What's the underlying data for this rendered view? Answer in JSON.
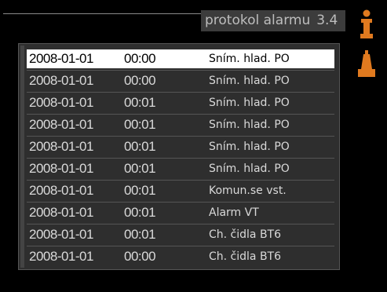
{
  "header": {
    "title": "protokol alarmu",
    "menu_number": "3.4"
  },
  "icons": {
    "info": "info-icon",
    "alarm": "alarm-lamp-icon",
    "accent_color": "#e07a1f"
  },
  "alarm_log": {
    "rows": [
      {
        "date": "2008-01-01",
        "time": "00:00",
        "alarm": "Sním. hlad. PO",
        "selected": true
      },
      {
        "date": "2008-01-01",
        "time": "00:00",
        "alarm": "Sním. hlad. PO",
        "selected": false
      },
      {
        "date": "2008-01-01",
        "time": "00:01",
        "alarm": "Sním. hlad. PO",
        "selected": false
      },
      {
        "date": "2008-01-01",
        "time": "00:01",
        "alarm": "Sním. hlad. PO",
        "selected": false
      },
      {
        "date": "2008-01-01",
        "time": "00:01",
        "alarm": "Sním. hlad. PO",
        "selected": false
      },
      {
        "date": "2008-01-01",
        "time": "00:01",
        "alarm": "Sním. hlad. PO",
        "selected": false
      },
      {
        "date": "2008-01-01",
        "time": "00:01",
        "alarm": "Komun.se vst.",
        "selected": false
      },
      {
        "date": "2008-01-01",
        "time": "00:01",
        "alarm": "Alarm VT",
        "selected": false
      },
      {
        "date": "2008-01-01",
        "time": "00:01",
        "alarm": "Ch. čidla BT6",
        "selected": false
      },
      {
        "date": "2008-01-01",
        "time": "00:00",
        "alarm": "Ch. čidla BT6",
        "selected": false
      }
    ]
  }
}
